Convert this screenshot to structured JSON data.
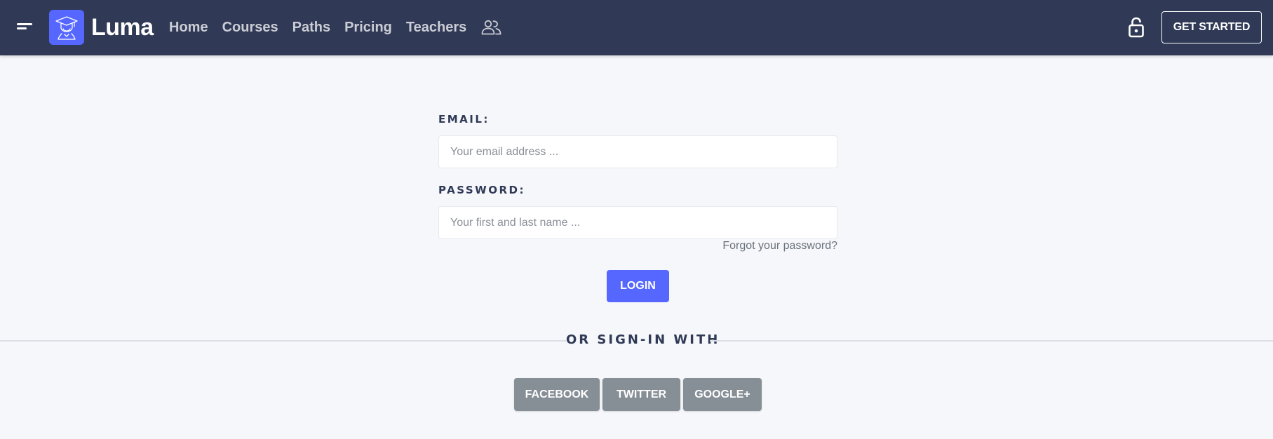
{
  "navbar": {
    "brand": "Luma",
    "links": [
      "Home",
      "Courses",
      "Paths",
      "Pricing",
      "Teachers"
    ],
    "cta_label": "GET STARTED",
    "icons": {
      "menu": "menu-icon",
      "logo": "graduate-logo-icon",
      "teachers": "people-icon",
      "lock": "lock-icon"
    }
  },
  "login_form": {
    "email_label": "EMAIL:",
    "email_placeholder": "Your email address ...",
    "password_label": "PASSWORD:",
    "password_placeholder": "Your first and last name ...",
    "forgot_link": "Forgot your password?",
    "login_button": "LOGIN"
  },
  "social": {
    "divider_text": "OR SIGN-IN WITH",
    "buttons": [
      "FACEBOOK",
      "TWITTER",
      "GOOGLE+"
    ]
  },
  "colors": {
    "navbar_bg": "#303956",
    "page_bg": "#f5f7fa",
    "primary": "#5567ff",
    "social_button": "#868e96",
    "label_text": "#303956"
  }
}
